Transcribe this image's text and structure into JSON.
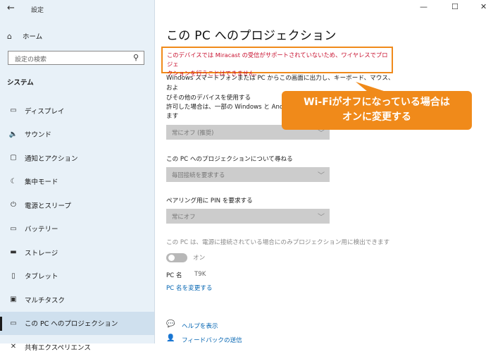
{
  "window": {
    "title": "設定",
    "controls": {
      "minimize": "—",
      "maximize": "☐",
      "close": "✕"
    }
  },
  "sidebar": {
    "home_label": "ホーム",
    "search_placeholder": "設定の検索",
    "section_title": "システム",
    "items": [
      {
        "icon": "display-icon",
        "glyph": "▭",
        "label": "ディスプレイ",
        "active": false
      },
      {
        "icon": "sound-icon",
        "glyph": "🔈",
        "label": "サウンド",
        "active": false
      },
      {
        "icon": "notification-icon",
        "glyph": "▢",
        "label": "通知とアクション",
        "active": false
      },
      {
        "icon": "focus-assist-icon",
        "glyph": "☾",
        "label": "集中モード",
        "active": false
      },
      {
        "icon": "power-icon",
        "glyph": "⏻",
        "label": "電源とスリープ",
        "active": false
      },
      {
        "icon": "battery-icon",
        "glyph": "▭",
        "label": "バッテリー",
        "active": false
      },
      {
        "icon": "storage-icon",
        "glyph": "▬",
        "label": "ストレージ",
        "active": false
      },
      {
        "icon": "tablet-icon",
        "glyph": "▯",
        "label": "タブレット",
        "active": false
      },
      {
        "icon": "multitask-icon",
        "glyph": "▣",
        "label": "マルチタスク",
        "active": false
      },
      {
        "icon": "projection-icon",
        "glyph": "▭",
        "label": "この PC へのプロジェクション",
        "active": true
      },
      {
        "icon": "shared-experience-icon",
        "glyph": "✕",
        "label": "共有エクスペリエンス",
        "active": false
      }
    ]
  },
  "main": {
    "title": "この PC へのプロジェクション",
    "warning_line1": "このデバイスでは Miracast の受信がサポートされていないため、ワイヤレスでプロジェ",
    "warning_line2": "クションを行うことはできません。",
    "description_line1": "Windows スマートフォンまたは PC からこの画面に出力し、キーボード、マウス、およ",
    "description_line2": "びその他のデバイスを使用する",
    "allow_label_line1": "許可した場合は、一部の Windows と Andr",
    "allow_label_line2": "ます",
    "allow_value": "常にオフ (推奨)",
    "ask_label": "この PC へのプロジェクションについて尋ねる",
    "ask_value": "毎回接続を要求する",
    "pin_label": "ペアリング用に PIN を要求する",
    "pin_value": "常にオフ",
    "power_detect_label": "この PC は、電源に接続されている場合にのみプロジェクション用に検出できます",
    "toggle_state": "オン",
    "pc_name_key": "PC 名",
    "pc_name_value": "T9K",
    "rename_link": "PC 名を変更する",
    "help_link": "ヘルプを表示",
    "feedback_link": "フィードバックの送信"
  },
  "callout": {
    "line1": "Wi-Fiがオフになっている場合は",
    "line2": "オンに変更する",
    "color": "#f08a1a"
  },
  "colors": {
    "sidebar_bg": "#e8f1f8",
    "warning_text": "#c8102e",
    "link": "#0063b1"
  }
}
